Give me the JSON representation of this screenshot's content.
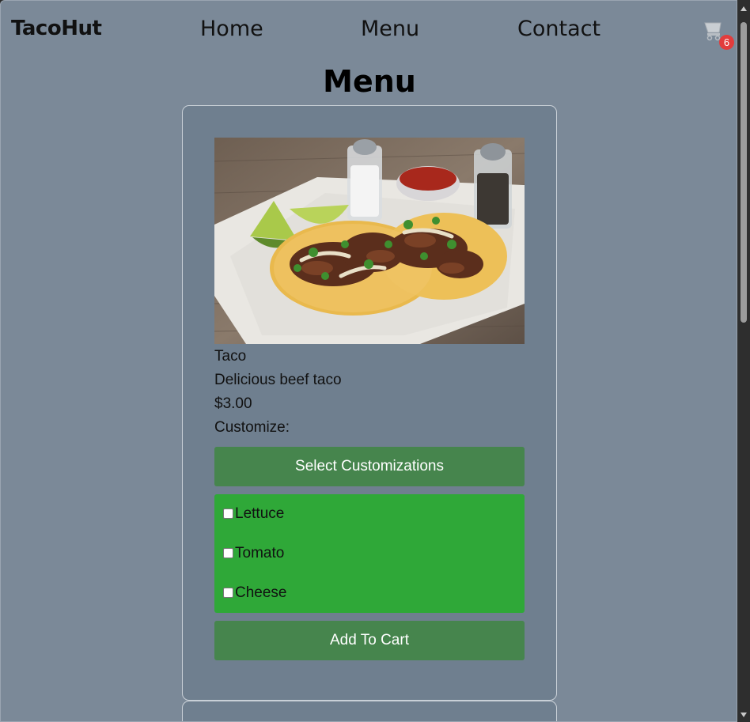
{
  "navbar": {
    "brand": "TacoHut",
    "links": [
      "Home",
      "Menu",
      "Contact"
    ],
    "cart_icon": "shopping-cart-icon",
    "cart_count": "6"
  },
  "page": {
    "heading": "Menu"
  },
  "menu_item": {
    "name": "Taco",
    "description": "Delicious beef taco",
    "price": "$3.00",
    "customize_label": "Customize:",
    "select_button": "Select Customizations",
    "options": [
      "Lettuce",
      "Tomato",
      "Cheese"
    ],
    "add_button": "Add To Cart",
    "photo": "tacos-photo"
  },
  "colors": {
    "page_bg": "#7b8998",
    "card_bg": "#6f7f8f",
    "button_green": "#46854d",
    "options_green": "#2fa838",
    "badge_red": "#e23c3c"
  }
}
